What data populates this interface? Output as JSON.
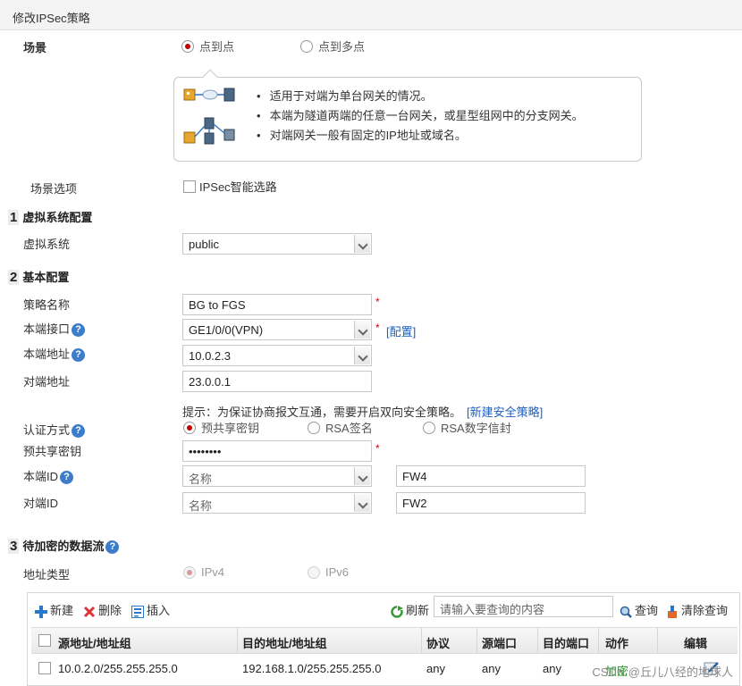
{
  "window": {
    "title": "修改IPSec策略"
  },
  "scenario": {
    "label": "场景",
    "options": [
      {
        "label": "点到点",
        "selected": true
      },
      {
        "label": "点到多点",
        "selected": false
      }
    ],
    "tips": [
      "适用于对端为单台网关的情况。",
      "本端为隧道两端的任意一台网关，或星型组网中的分支网关。",
      "对端网关一般有固定的IP地址或域名。"
    ],
    "option_label": "场景选项",
    "smart_route_label": "IPSec智能选路"
  },
  "vsys": {
    "number": "1",
    "title": "虚拟系统配置",
    "label": "虚拟系统",
    "value": "public"
  },
  "basic": {
    "number": "2",
    "title": "基本配置",
    "policy_name": {
      "label": "策略名称",
      "value": "BG to FGS",
      "required": "*"
    },
    "local_interface": {
      "label": "本端接口",
      "value": "GE1/0/0(VPN)",
      "required": "*",
      "config_link": "[配置]"
    },
    "local_address": {
      "label": "本端地址",
      "value": "10.0.2.3"
    },
    "peer_address": {
      "label": "对端地址",
      "value": "23.0.0.1"
    },
    "hint": {
      "text": "提示：为保证协商报文互通，需要开启双向安全策略。",
      "link": "[新建安全策略]"
    },
    "auth": {
      "label": "认证方式",
      "options": [
        {
          "label": "预共享密钥",
          "selected": true
        },
        {
          "label": "RSA签名",
          "selected": false
        },
        {
          "label": "RSA数字信封",
          "selected": false
        }
      ]
    },
    "psk": {
      "label": "预共享密钥",
      "value": "••••••••",
      "required": "*"
    },
    "local_id": {
      "label": "本端ID",
      "type": "名称",
      "value": "FW4"
    },
    "peer_id": {
      "label": "对端ID",
      "type": "名称",
      "value": "FW2"
    }
  },
  "flow": {
    "number": "3",
    "title": "待加密的数据流",
    "addr_type_label": "地址类型",
    "addr_types": [
      {
        "label": "IPv4",
        "selected": true
      },
      {
        "label": "IPv6",
        "selected": false
      }
    ],
    "toolbar": {
      "new": "新建",
      "delete": "删除",
      "insert": "插入",
      "refresh": "刷新",
      "search_placeholder": "请输入要查询的内容",
      "query": "查询",
      "clear": "清除查询"
    },
    "columns": [
      "源地址/地址组",
      "目的地址/地址组",
      "协议",
      "源端口",
      "目的端口",
      "动作",
      "编辑"
    ],
    "rows": [
      {
        "src": "10.0.2.0/255.255.255.0",
        "dst": "192.168.1.0/255.255.255.0",
        "protocol": "any",
        "src_port": "any",
        "dst_port": "any",
        "action": "加密"
      }
    ]
  },
  "watermark": "CSDN @丘儿八经的地球人"
}
